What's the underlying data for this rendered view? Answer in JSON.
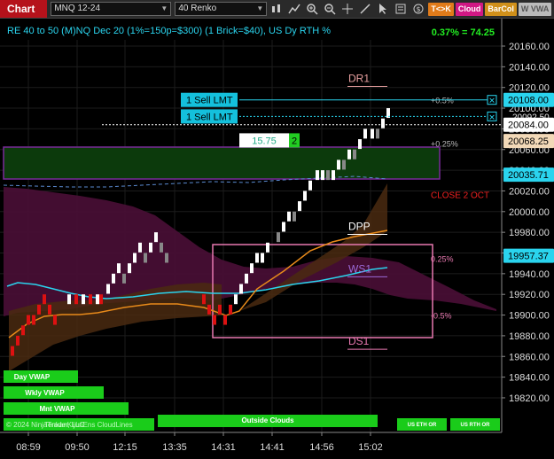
{
  "toolbar": {
    "title": "Chart",
    "instrument": "MNQ 12-24",
    "bar_type": "40 Renko",
    "buttons": [
      {
        "label": "T<>K",
        "bg": "#e07b1a",
        "fg": "#fff"
      },
      {
        "label": "Cloud",
        "bg": "#d01884",
        "fg": "#fff"
      },
      {
        "label": "BarCol",
        "bg": "#d0901a",
        "fg": "#fff"
      },
      {
        "label": "W VWA",
        "bg": "#bbbbbb",
        "fg": "#555"
      }
    ]
  },
  "chart": {
    "header": "RE 40 to 50 (M)NQ Dec 20 (1%=150p=$300) (1 Brick=$40), US Dy RTH %",
    "pct_change": "0.37% = 74.25",
    "x_ticks": [
      "08:59",
      "09:50",
      "12:15",
      "13:35",
      "14:31",
      "14:41",
      "14:56",
      "15:02"
    ],
    "y_ticks": [
      "20160.00",
      "20140.00",
      "20120.00",
      "20100.00",
      "20080.00",
      "20060.00",
      "20040.00",
      "20020.00",
      "20000.00",
      "19980.00",
      "19960.00",
      "19940.00",
      "19920.00",
      "19900.00",
      "19880.00",
      "19860.00",
      "19840.00",
      "19820.00"
    ],
    "price_tags": [
      {
        "price": 20108,
        "text": "20108.00",
        "bg": "#2ad4ee",
        "fg": "#000"
      },
      {
        "price": 20084,
        "text": "20084.00",
        "bg": "#ffffff",
        "fg": "#000"
      },
      {
        "price": 20068.25,
        "text": "20068.25",
        "bg": "#f2d9b8",
        "fg": "#000"
      },
      {
        "price": 20035.71,
        "text": "20035.71",
        "bg": "#2ad4ee",
        "fg": "#000"
      },
      {
        "price": 19957.37,
        "text": "19957.37",
        "bg": "#2ad4ee",
        "fg": "#000"
      }
    ],
    "orders": [
      {
        "label": "1 Sell LMT",
        "price": 20108
      },
      {
        "label": "1 Sell LMT",
        "price": 20092
      }
    ],
    "order_partial_text": "20092.50",
    "levels": [
      {
        "label": "DR1",
        "price": 20121,
        "color": "#e8a0a0"
      },
      {
        "label": "DPP",
        "price": 19978,
        "color": "#ffffff"
      },
      {
        "label": "WS1",
        "price": 19937,
        "color": "#9c6bd9"
      },
      {
        "label": "DS1",
        "price": 19867,
        "color": "#e878b0"
      }
    ],
    "pct_labels": [
      {
        "text": "+0.5%",
        "price": 20108
      },
      {
        "text": "+0.25%",
        "price": 20066
      },
      {
        "text": "0.25%",
        "price": 19955
      },
      {
        "text": "-0.5%",
        "price": 19900
      }
    ],
    "position_box": {
      "value": "15.75",
      "qty": "2"
    },
    "close_label": "CLOSE 2 OCT",
    "vwap_buttons": [
      "Day VWAP",
      "Wkly VWAP",
      "Mnt VWAP"
    ],
    "bottom_bars": [
      "Outside Clouds",
      "US ETH OR",
      "US RTH OR"
    ],
    "copyright": "© 2024 NinjaTrader, LLC",
    "indicator_label": "TenkanKijunEns CloudLines",
    "colors": {
      "up_brick": "#ffffff",
      "down_brick": "#dd1111",
      "cyan": "#2ad4ee",
      "orange": "#e88a1a",
      "magenta": "#b0208a",
      "green": "#22cc22"
    }
  }
}
